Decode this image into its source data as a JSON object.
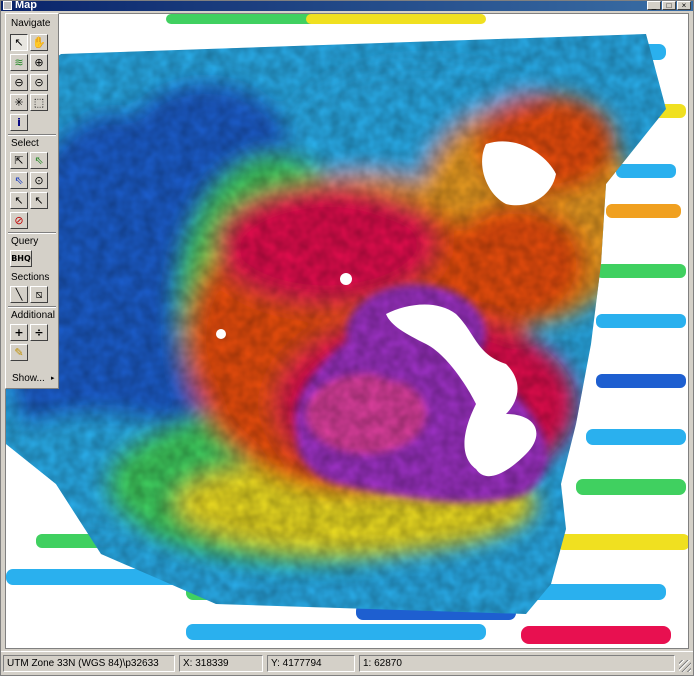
{
  "window": {
    "title": "Map"
  },
  "toolbox": {
    "sections": {
      "navigate": "Navigate",
      "select": "Select",
      "query": "Query",
      "sections": "Sections",
      "additional": "Additional"
    },
    "tools": {
      "pointer": "↖",
      "pan": "✋",
      "layers": "≋",
      "zoom_in": "⊕",
      "zoom_out": "⊖",
      "zoom_out_alt": "⊝",
      "full_extent": "✳",
      "zoom_box": "⬚",
      "info": "i",
      "select_box": "⇱",
      "select_arrow": "⇖",
      "select_blue": "⇖",
      "select_circle": "⊙",
      "select_point": "↖",
      "select_point2": "↖",
      "clear": "⊘",
      "query": "BHQ",
      "section_line": "╲",
      "section_box": "⧅",
      "add": "+",
      "divide": "÷",
      "pencil": "✎"
    },
    "show_label": "Show...",
    "show_arrow": "▸"
  },
  "status": {
    "projection": "UTM Zone 33N (WGS 84)\\p32633",
    "x": "X: 318339",
    "y": "Y: 4177794",
    "scale": "1: 62870"
  },
  "colors": {
    "low": "#1e5fd0",
    "mid_low": "#2ab0ee",
    "mid": "#40d060",
    "mid_high": "#f0e020",
    "high": "#f05010",
    "very_high": "#e81050",
    "max": "#a030c8"
  }
}
